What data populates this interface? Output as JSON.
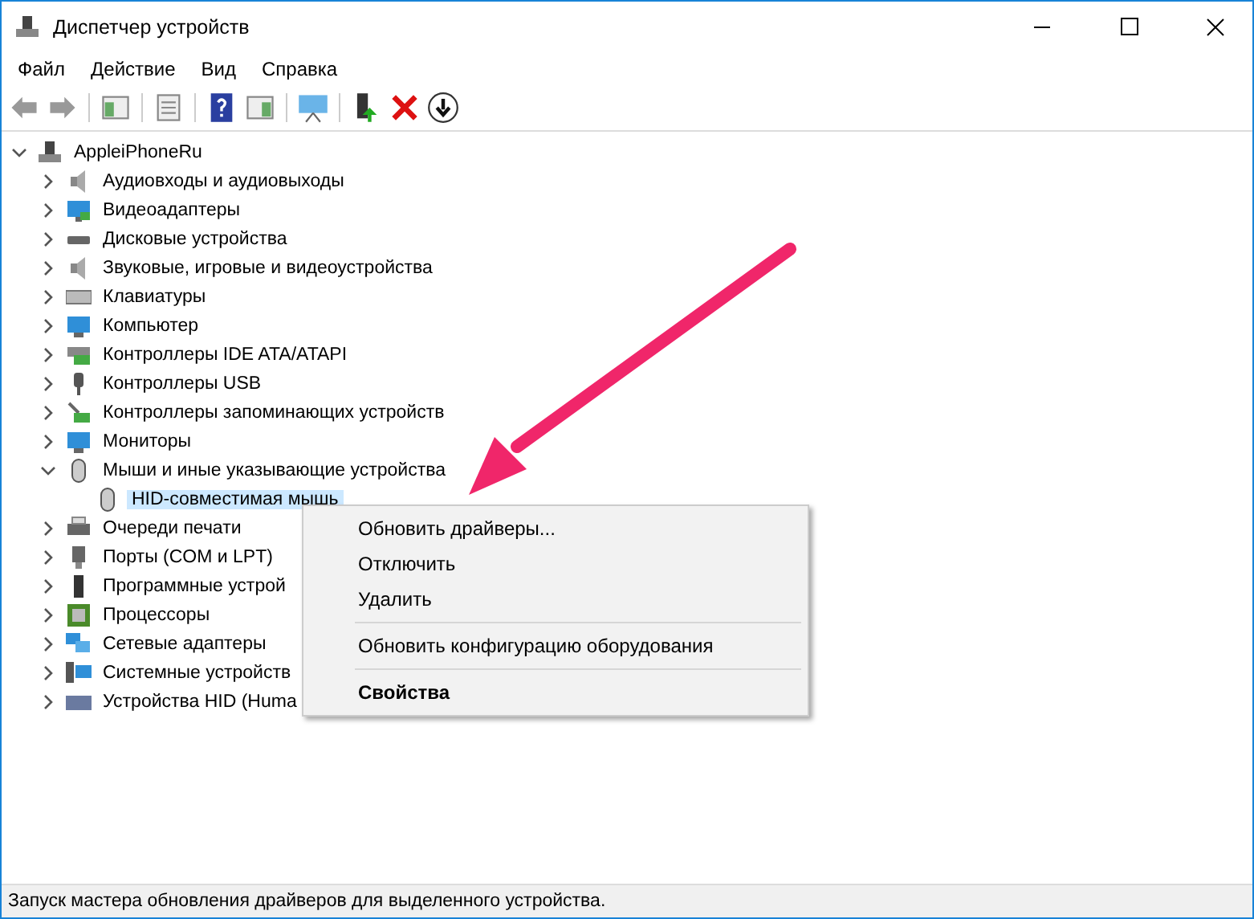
{
  "window": {
    "title": "Диспетчер устройств"
  },
  "menu_bar": [
    "Файл",
    "Действие",
    "Вид",
    "Справка"
  ],
  "tree": {
    "label": "AppleiPhoneRu",
    "expanded": true,
    "children": [
      {
        "label": "Аудиовходы и аудиовыходы",
        "expanded": false
      },
      {
        "label": "Видеоадаптеры",
        "expanded": false
      },
      {
        "label": "Дисковые устройства",
        "expanded": false
      },
      {
        "label": "Звуковые, игровые и видеоустройства",
        "expanded": false
      },
      {
        "label": "Клавиатуры",
        "expanded": false
      },
      {
        "label": "Компьютер",
        "expanded": false
      },
      {
        "label": "Контроллеры IDE ATA/ATAPI",
        "expanded": false
      },
      {
        "label": "Контроллеры USB",
        "expanded": false
      },
      {
        "label": "Контроллеры запоминающих устройств",
        "expanded": false
      },
      {
        "label": "Мониторы",
        "expanded": false
      },
      {
        "label": "Мыши и иные указывающие устройства",
        "expanded": true,
        "children": [
          {
            "label": "HID-совместимая мышь",
            "selected": true
          }
        ]
      },
      {
        "label": "Очереди печати",
        "expanded": false
      },
      {
        "label": "Порты (COM и LPT)",
        "expanded": false
      },
      {
        "label": "Программные устрой",
        "expanded": false
      },
      {
        "label": "Процессоры",
        "expanded": false
      },
      {
        "label": "Сетевые адаптеры",
        "expanded": false
      },
      {
        "label": "Системные устройств",
        "expanded": false
      },
      {
        "label": "Устройства HID (Huma",
        "expanded": false
      }
    ]
  },
  "context_menu": [
    {
      "kind": "item",
      "label": "Обновить драйверы...",
      "default": false
    },
    {
      "kind": "item",
      "label": "Отключить",
      "default": false
    },
    {
      "kind": "item",
      "label": "Удалить",
      "default": false
    },
    {
      "kind": "separator"
    },
    {
      "kind": "item",
      "label": "Обновить конфигурацию оборудования",
      "default": false
    },
    {
      "kind": "separator"
    },
    {
      "kind": "item",
      "label": "Свойства",
      "default": true
    }
  ],
  "status_bar": "Запуск мастера обновления драйверов для выделенного устройства."
}
